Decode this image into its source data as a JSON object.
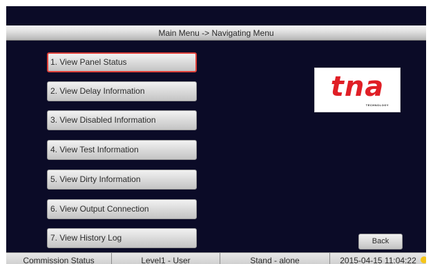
{
  "header": {
    "title": "Main Menu -> Navigating Menu"
  },
  "menu": {
    "items": [
      {
        "label": "1. View Panel Status"
      },
      {
        "label": "2. View Delay Information"
      },
      {
        "label": "3. View Disabled Information"
      },
      {
        "label": "4. View Test Information"
      },
      {
        "label": "5. View Dirty Information"
      },
      {
        "label": "6. View Output Connection"
      },
      {
        "label": "7. View History Log"
      }
    ],
    "selected_index": 0
  },
  "logo": {
    "text": "tna",
    "subtext": "TECHNOLOGY"
  },
  "back_button": {
    "label": "Back"
  },
  "status_bar": {
    "commission_status": "Commission Status",
    "user_level": "Level1 - User",
    "mode": "Stand - alone",
    "datetime": "2015-04-15 11:04:22"
  },
  "colors": {
    "background": "#0b0b27",
    "selected_border": "#e0413a",
    "logo_red": "#e01f26",
    "status_indicator": "#f5c518"
  }
}
